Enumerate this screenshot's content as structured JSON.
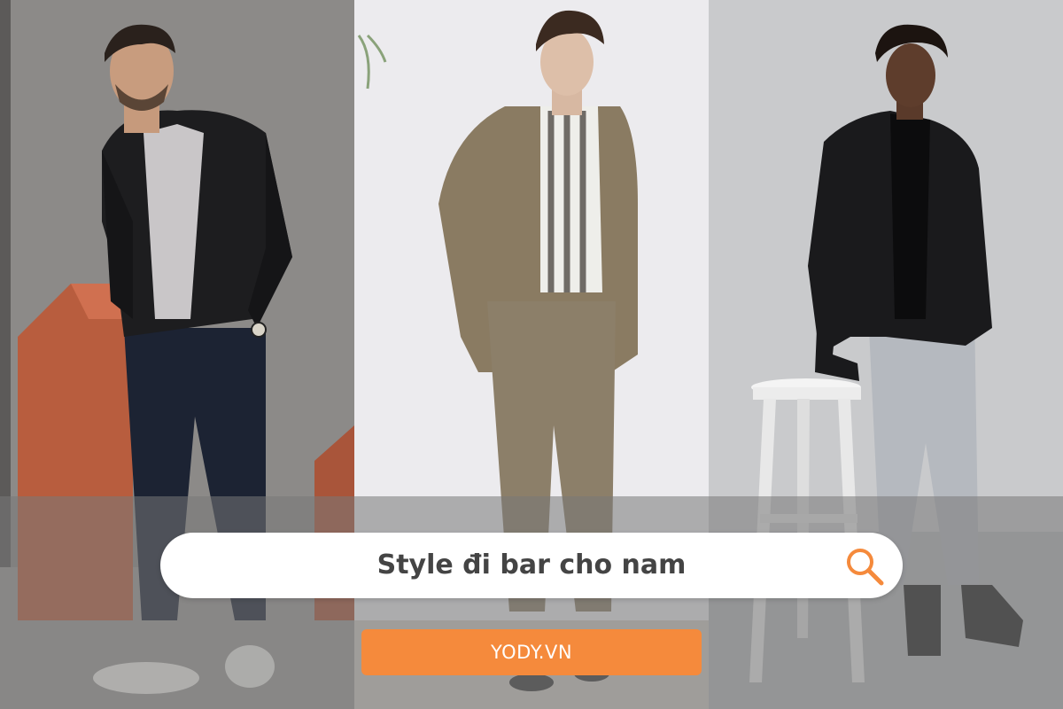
{
  "search": {
    "query": "Style đi bar cho nam"
  },
  "brand": {
    "label": "YODY.VN"
  },
  "colors": {
    "accent": "#f58a3c",
    "search_text": "#444444",
    "search_bg": "#ffffff"
  },
  "icons": {
    "search": "search-icon"
  }
}
